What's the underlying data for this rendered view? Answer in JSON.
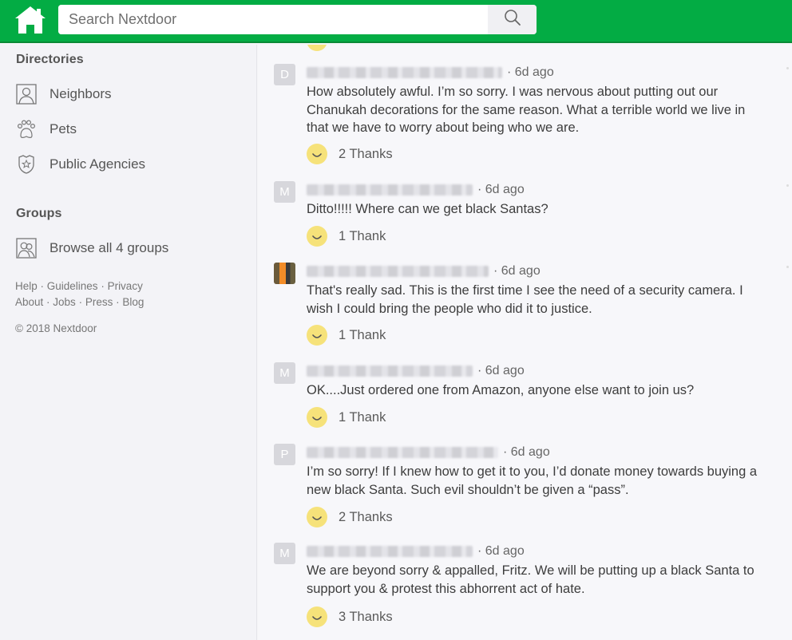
{
  "header": {
    "logo": "home-icon",
    "search_placeholder": "Search Nextdoor",
    "search_value": "",
    "search_icon": "search-icon"
  },
  "sidebar": {
    "directories_title": "Directories",
    "directories": [
      {
        "label": "Neighbors",
        "icon": "person-icon"
      },
      {
        "label": "Pets",
        "icon": "paw-icon"
      },
      {
        "label": "Public Agencies",
        "icon": "badge-icon"
      }
    ],
    "groups_title": "Groups",
    "groups": [
      {
        "label": "Browse all 4 groups",
        "icon": "group-icon"
      }
    ],
    "footer_row1": [
      "Help",
      "Guidelines",
      "Privacy"
    ],
    "footer_row2": [
      "About",
      "Jobs",
      "Press",
      "Blog"
    ],
    "separator": " · ",
    "copyright": "© 2018 Nextdoor"
  },
  "comments": [
    {
      "avatar_letter": "D",
      "time": "· 6d ago",
      "text": "How absolutely awful. I’m so sorry. I was nervous about putting out our Chanukah decorations for the same reason. What a terrible world we live in that we have to worry about being who we are.",
      "thanks": "2 Thanks"
    },
    {
      "avatar_letter": "M",
      "time": "· 6d ago",
      "text": "Ditto!!!!! Where can we get black Santas?",
      "thanks": "1 Thank"
    },
    {
      "avatar_letter": "",
      "time": "· 6d ago",
      "text": "That's really sad. This is the first time I see the need of a security camera. I wish I could bring the people who did it to justice.",
      "thanks": "1 Thank"
    },
    {
      "avatar_letter": "M",
      "time": "· 6d ago",
      "text": "OK....Just ordered one from Amazon, anyone else want to join us?",
      "thanks": "1 Thank"
    },
    {
      "avatar_letter": "P",
      "time": "· 6d ago",
      "text": "I’m so sorry!  If I knew how to get it to you, I’d donate money towards buying a new black Santa.  Such evil shouldn’t be given a “pass”.",
      "thanks": "2 Thanks"
    },
    {
      "avatar_letter": "M",
      "time": "· 6d ago",
      "text": "We are beyond sorry & appalled, Fritz. We will be putting up a black Santa to support you & protest this abhorrent act of hate.",
      "thanks": "3 Thanks"
    }
  ],
  "colors": {
    "brand_green": "#03ac44",
    "smiley_yellow": "#f6e27a"
  }
}
